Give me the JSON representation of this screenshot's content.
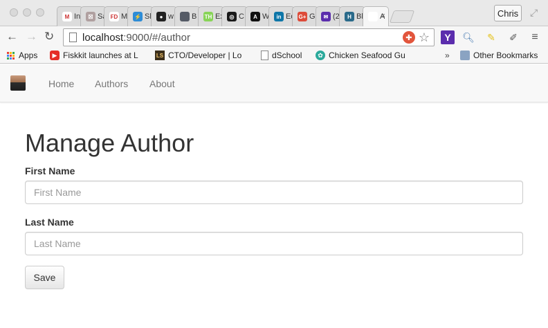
{
  "browser": {
    "tabs": [
      {
        "label": "In",
        "icon": "gmail-icon",
        "color": "#ffffff",
        "glyph": "M"
      },
      {
        "label": "Sa",
        "icon": "salesforce-icon",
        "color": "#b0a0a0",
        "glyph": "☒"
      },
      {
        "label": "M",
        "icon": "fd-icon",
        "color": "#ffffff",
        "glyph": "FD"
      },
      {
        "label": "Sl",
        "icon": "slides-icon",
        "color": "#2d8cd6",
        "glyph": "⚡"
      },
      {
        "label": "w",
        "icon": "github-icon",
        "color": "#222222",
        "glyph": "●"
      },
      {
        "label": "B",
        "icon": "bookmark-icon",
        "color": "#555b66",
        "glyph": ""
      },
      {
        "label": "Ex",
        "icon": "treehouse-icon",
        "color": "#88d458",
        "glyph": "TH"
      },
      {
        "label": "C",
        "icon": "circle-icon",
        "color": "#1a1a1a",
        "glyph": "◎"
      },
      {
        "label": "W",
        "icon": "angular-icon",
        "color": "#111111",
        "glyph": "A"
      },
      {
        "label": "Ed",
        "icon": "linkedin-icon",
        "color": "#0e76a8",
        "glyph": "in"
      },
      {
        "label": "G",
        "icon": "google-plus-icon",
        "color": "#dd4b39",
        "glyph": "G+"
      },
      {
        "label": "(2",
        "icon": "yahoo-mail-icon",
        "color": "#5b2dad",
        "glyph": "✉"
      },
      {
        "label": "Bl",
        "icon": "h-icon",
        "color": "#2a6a8a",
        "glyph": "H"
      },
      {
        "label": "A",
        "icon": "page-icon",
        "color": "#ffffff",
        "glyph": "",
        "active": true
      }
    ],
    "close_glyph": "×",
    "profile_name": "Chris",
    "url_host": "localhost",
    "url_rest": ":9000/#/author"
  },
  "bookmarks": {
    "apps": "Apps",
    "fiskkit": "Fiskkit launches at L",
    "cto": "CTO/Developer | Lo",
    "dschool": "dSchool",
    "chicken": "Chicken Seafood Gu",
    "more": "»",
    "other": "Other Bookmarks"
  },
  "nav": {
    "home": "Home",
    "authors": "Authors",
    "about": "About"
  },
  "page": {
    "heading": "Manage Author",
    "first_name_label": "First Name",
    "first_name_placeholder": "First Name",
    "last_name_label": "Last Name",
    "last_name_placeholder": "Last Name",
    "save_label": "Save"
  }
}
